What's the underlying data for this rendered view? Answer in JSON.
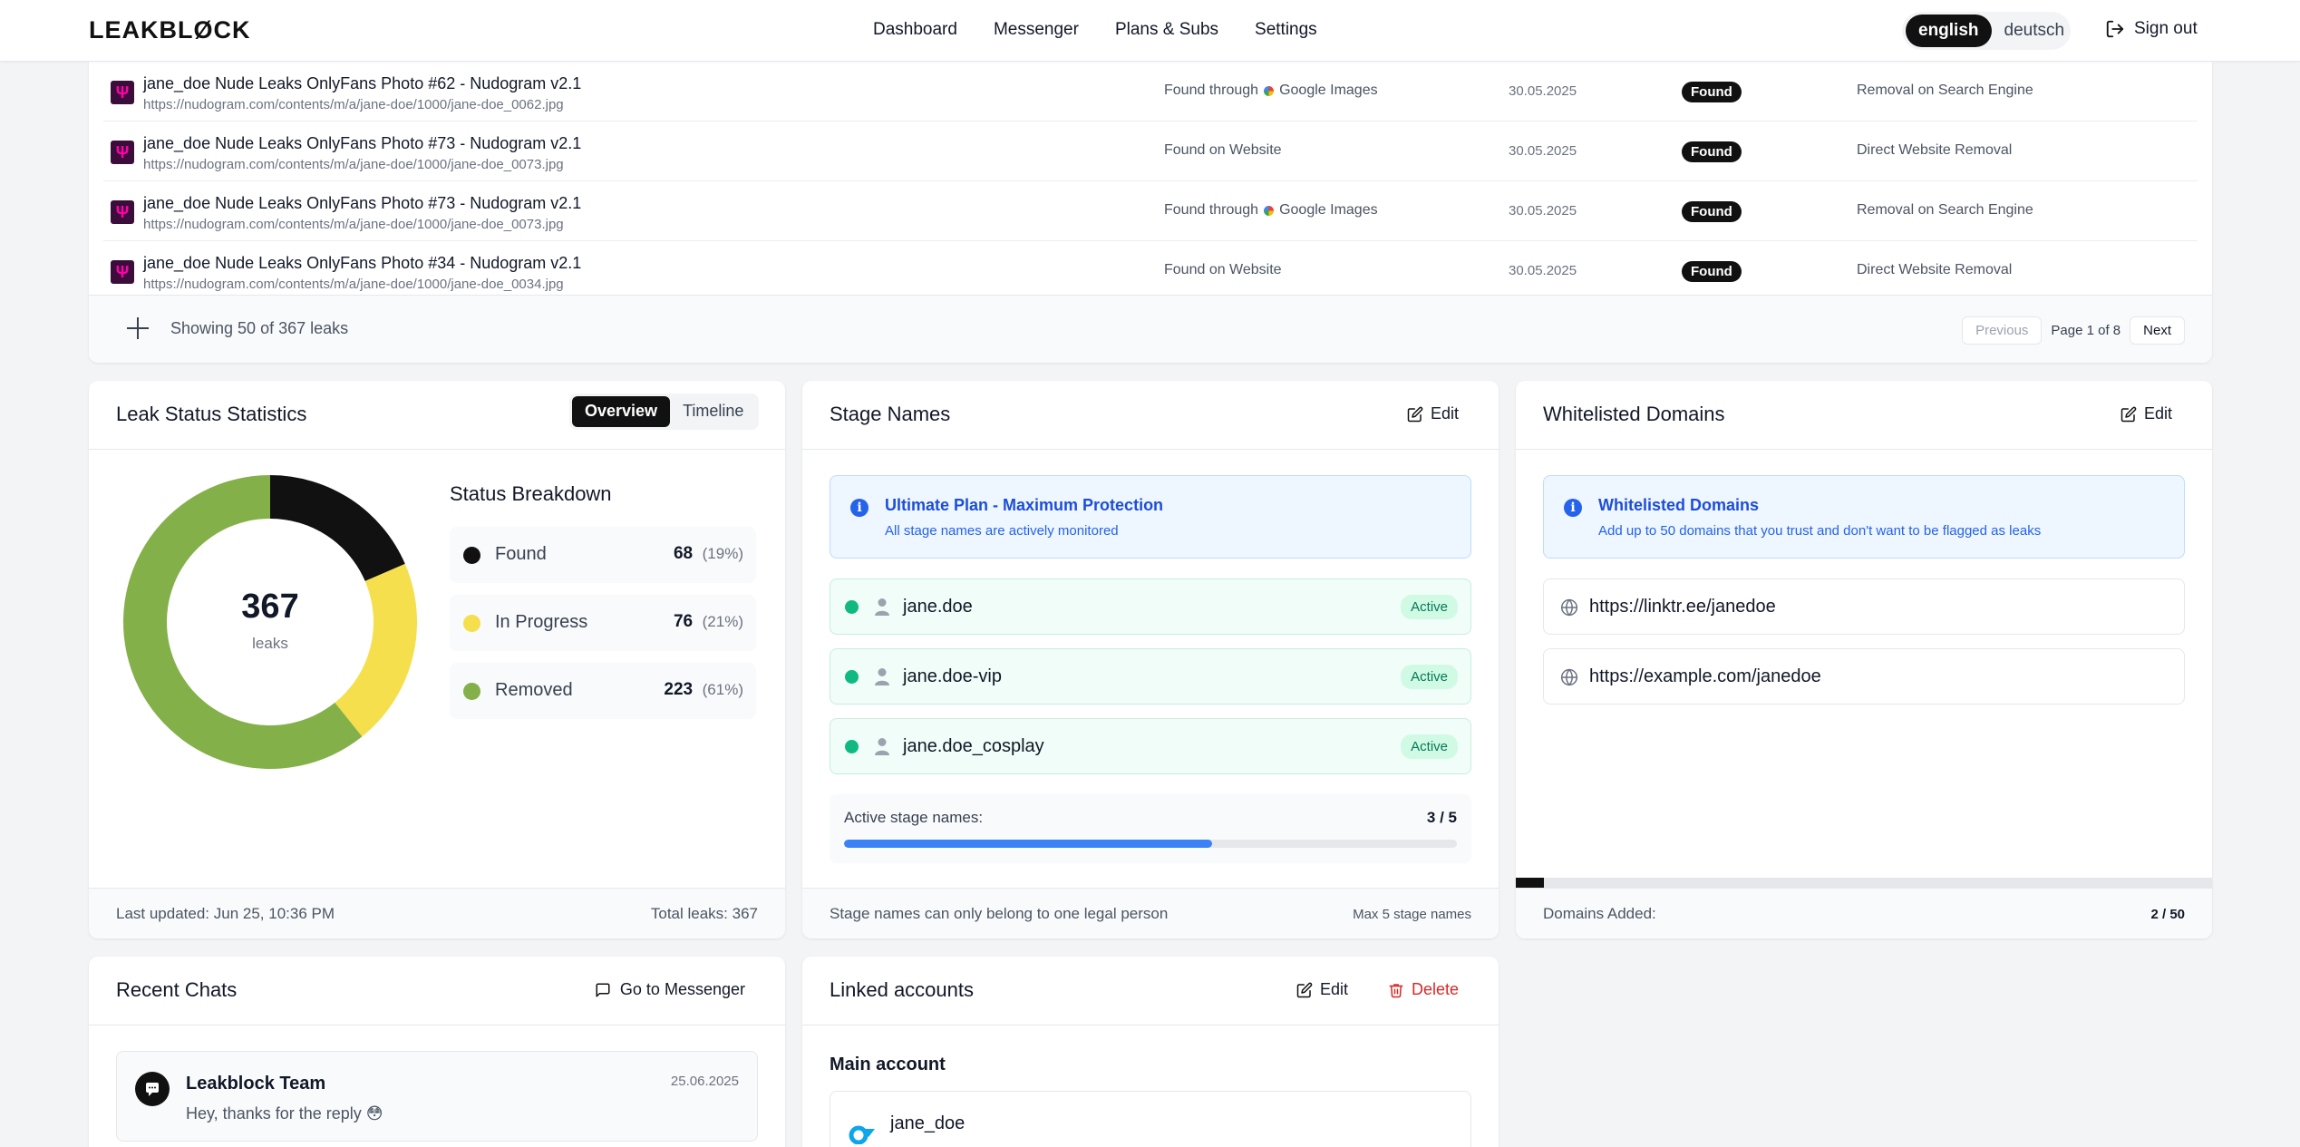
{
  "header": {
    "logo": "LEAKBLØCK",
    "nav": [
      "Dashboard",
      "Messenger",
      "Plans & Subs",
      "Settings"
    ],
    "languages": {
      "english": "english",
      "deutsch": "deutsch"
    },
    "sign_out": "Sign out"
  },
  "leaks": {
    "rows": [
      {
        "title": "jane_doe Nude Leaks OnlyFans Photo #62 - Nudogram v2.1",
        "url": "https://nudogram.com/contents/m/a/jane-doe/1000/jane-doe_0062.jpg",
        "source_prefix": "Found through",
        "source_name": "Google Images",
        "date": "30.05.2025",
        "status": "Found",
        "removal": "Removal on Search Engine",
        "google": true
      },
      {
        "title": "jane_doe Nude Leaks OnlyFans Photo #73 - Nudogram v2.1",
        "url": "https://nudogram.com/contents/m/a/jane-doe/1000/jane-doe_0073.jpg",
        "source_prefix": "Found on Website",
        "source_name": "",
        "date": "30.05.2025",
        "status": "Found",
        "removal": "Direct Website Removal",
        "google": false
      },
      {
        "title": "jane_doe Nude Leaks OnlyFans Photo #73 - Nudogram v2.1",
        "url": "https://nudogram.com/contents/m/a/jane-doe/1000/jane-doe_0073.jpg",
        "source_prefix": "Found through",
        "source_name": "Google Images",
        "date": "30.05.2025",
        "status": "Found",
        "removal": "Removal on Search Engine",
        "google": true
      },
      {
        "title": "jane_doe Nude Leaks OnlyFans Photo #34 - Nudogram v2.1",
        "url": "https://nudogram.com/contents/m/a/jane-doe/1000/jane-doe_0034.jpg",
        "source_prefix": "Found on Website",
        "source_name": "",
        "date": "30.05.2025",
        "status": "Found",
        "removal": "Direct Website Removal",
        "google": false
      }
    ],
    "showing": "Showing 50 of 367 leaks",
    "pager": {
      "previous": "Previous",
      "info": "Page 1 of 8",
      "next": "Next"
    }
  },
  "stats": {
    "title": "Leak Status Statistics",
    "tabs": {
      "overview": "Overview",
      "timeline": "Timeline"
    },
    "total": "367",
    "total_label": "leaks",
    "breakdown_title": "Status Breakdown",
    "items": [
      {
        "label": "Found",
        "count": "68",
        "pct": "(19%)",
        "value": 68,
        "color": "#111111"
      },
      {
        "label": "In Progress",
        "count": "76",
        "pct": "(21%)",
        "value": 76,
        "color": "#f5df4d"
      },
      {
        "label": "Removed",
        "count": "223",
        "pct": "(61%)",
        "value": 223,
        "color": "#84b04a"
      }
    ],
    "last_updated": "Last updated: Jun 25, 10:36 PM",
    "total_leaks": "Total leaks: 367"
  },
  "stage_names": {
    "title": "Stage Names",
    "edit": "Edit",
    "info_title": "Ultimate Plan - Maximum Protection",
    "info_sub": "All stage names are actively monitored",
    "names": [
      {
        "name": "jane.doe",
        "status": "Active"
      },
      {
        "name": "jane.doe-vip",
        "status": "Active"
      },
      {
        "name": "jane.doe_cosplay",
        "status": "Active"
      }
    ],
    "counter_label": "Active stage names:",
    "counter_value": "3 / 5",
    "counter_fraction": 0.6,
    "footer_left": "Stage names can only belong to one legal person",
    "footer_right": "Max 5 stage names"
  },
  "domains": {
    "title": "Whitelisted Domains",
    "edit": "Edit",
    "info_title": "Whitelisted Domains",
    "info_sub": "Add up to 50 domains that you trust and don't want to be flagged as leaks",
    "list": [
      "https://linktr.ee/janedoe",
      "https://example.com/janedoe"
    ],
    "added_fraction": 0.04,
    "footer_left": "Domains Added:",
    "footer_right": "2 / 50"
  },
  "chats": {
    "title": "Recent Chats",
    "go": "Go to Messenger",
    "item": {
      "name": "Leakblock Team",
      "message": "Hey, thanks for the reply 😳",
      "date": "25.06.2025"
    }
  },
  "linked": {
    "title": "Linked accounts",
    "edit": "Edit",
    "delete": "Delete",
    "main": "Main account",
    "account": "jane_doe"
  }
}
